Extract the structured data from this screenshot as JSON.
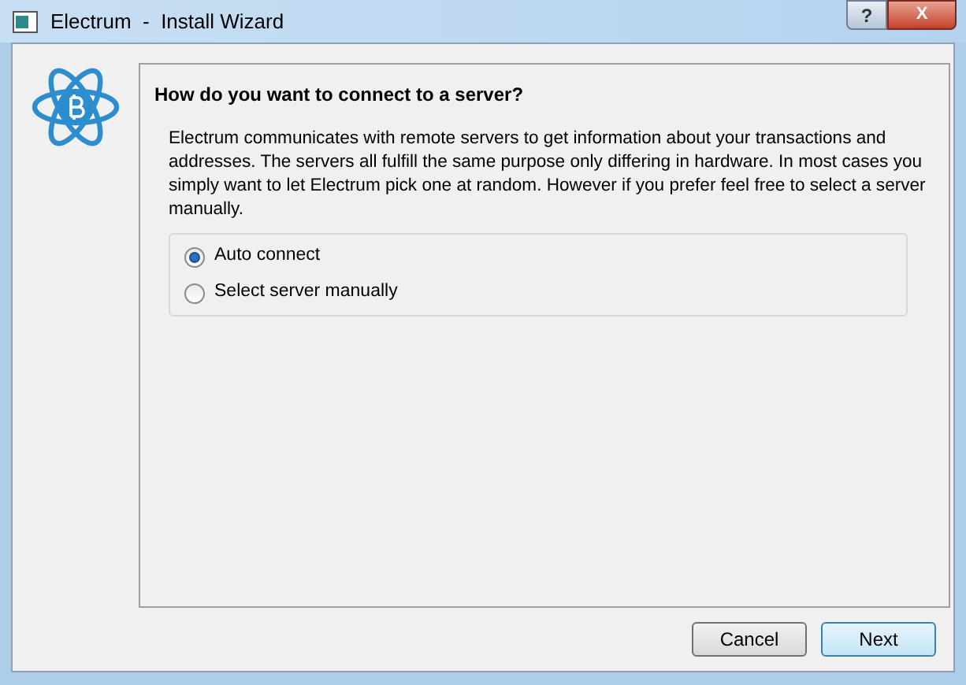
{
  "window": {
    "title": "Electrum  -  Install Wizard",
    "help_button": "?",
    "close_button": "X"
  },
  "page": {
    "heading": "How do you want to connect to a server?",
    "description": "Electrum communicates with remote servers to get information about your transactions and addresses. The servers all fulfill the same purpose only differing in hardware. In most cases you simply want to let Electrum pick one at random.  However if you prefer feel free to select a server manually.",
    "options": [
      {
        "label": "Auto connect",
        "selected": true
      },
      {
        "label": "Select server manually",
        "selected": false
      }
    ]
  },
  "buttons": [
    {
      "label": "Cancel",
      "default": false
    },
    {
      "label": "Next",
      "default": true
    }
  ]
}
